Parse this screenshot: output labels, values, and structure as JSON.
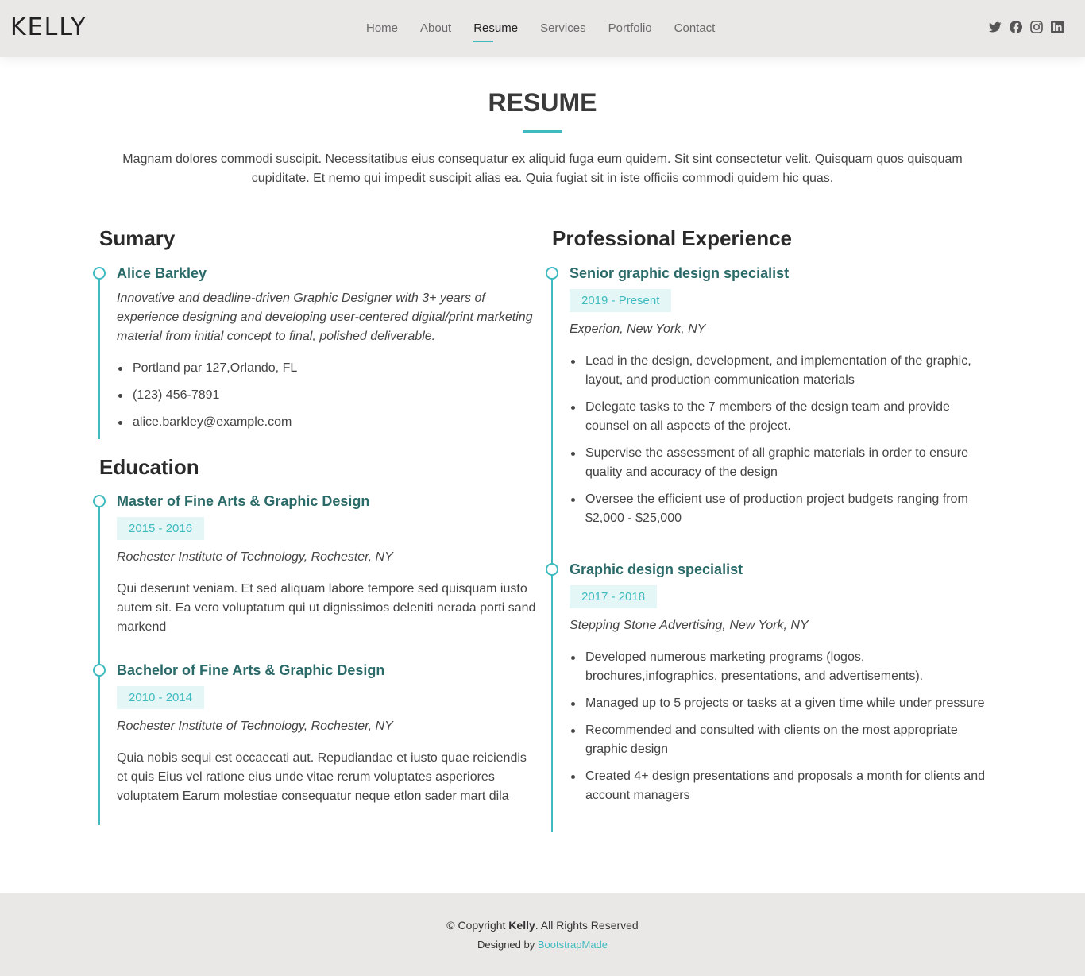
{
  "header": {
    "logo": "KELLY",
    "nav": [
      "Home",
      "About",
      "Resume",
      "Services",
      "Portfolio",
      "Contact"
    ],
    "active_nav": "Resume",
    "socials": [
      "twitter-icon",
      "facebook-icon",
      "instagram-icon",
      "linkedin-icon"
    ]
  },
  "section": {
    "title": "RESUME",
    "description": "Magnam dolores commodi suscipit. Necessitatibus eius consequatur ex aliquid fuga eum quidem. Sit sint consectetur velit. Quisquam quos quisquam cupiditate. Et nemo qui impedit suscipit alias ea. Quia fugiat sit in iste officiis commodi quidem hic quas."
  },
  "summary": {
    "heading": "Sumary",
    "name": "Alice Barkley",
    "bio": "Innovative and deadline-driven Graphic Designer with 3+ years of experience designing and developing user-centered digital/print marketing material from initial concept to final, polished deliverable.",
    "contacts": [
      "Portland par 127,Orlando, FL",
      "(123) 456-7891",
      "alice.barkley@example.com"
    ]
  },
  "education": {
    "heading": "Education",
    "items": [
      {
        "title": "Master of Fine Arts & Graphic Design",
        "years": "2015 - 2016",
        "school": "Rochester Institute of Technology, Rochester, NY",
        "text": "Qui deserunt veniam. Et sed aliquam labore tempore sed quisquam iusto autem sit. Ea vero voluptatum qui ut dignissimos deleniti nerada porti sand markend"
      },
      {
        "title": "Bachelor of Fine Arts & Graphic Design",
        "years": "2010 - 2014",
        "school": "Rochester Institute of Technology, Rochester, NY",
        "text": "Quia nobis sequi est occaecati aut. Repudiandae et iusto quae reiciendis et quis Eius vel ratione eius unde vitae rerum voluptates asperiores voluptatem Earum molestiae consequatur neque etlon sader mart dila"
      }
    ]
  },
  "experience": {
    "heading": "Professional Experience",
    "items": [
      {
        "title": "Senior graphic design specialist",
        "years": "2019 - Present",
        "company": "Experion, New York, NY",
        "bullets": [
          "Lead in the design, development, and implementation of the graphic, layout, and production communication materials",
          "Delegate tasks to the 7 members of the design team and provide counsel on all aspects of the project.",
          "Supervise the assessment of all graphic materials in order to ensure quality and accuracy of the design",
          "Oversee the efficient use of production project budgets ranging from $2,000 - $25,000"
        ]
      },
      {
        "title": "Graphic design specialist",
        "years": "2017 - 2018",
        "company": "Stepping Stone Advertising, New York, NY",
        "bullets": [
          "Developed numerous marketing programs (logos, brochures,infographics, presentations, and advertisements).",
          "Managed up to 5 projects or tasks at a given time while under pressure",
          "Recommended and consulted with clients on the most appropriate graphic design",
          "Created 4+ design presentations and proposals a month for clients and account managers"
        ]
      }
    ]
  },
  "footer": {
    "copyright_prefix": "© Copyright ",
    "brand": "Kelly",
    "copyright_suffix": ". All Rights Reserved",
    "designed_prefix": "Designed by ",
    "designer": "BootstrapMade"
  },
  "colors": {
    "accent": "#3fbbc0",
    "title": "#2a6a68",
    "header_bg": "#e9e8e6",
    "badge_bg": "#e4f6f5"
  }
}
